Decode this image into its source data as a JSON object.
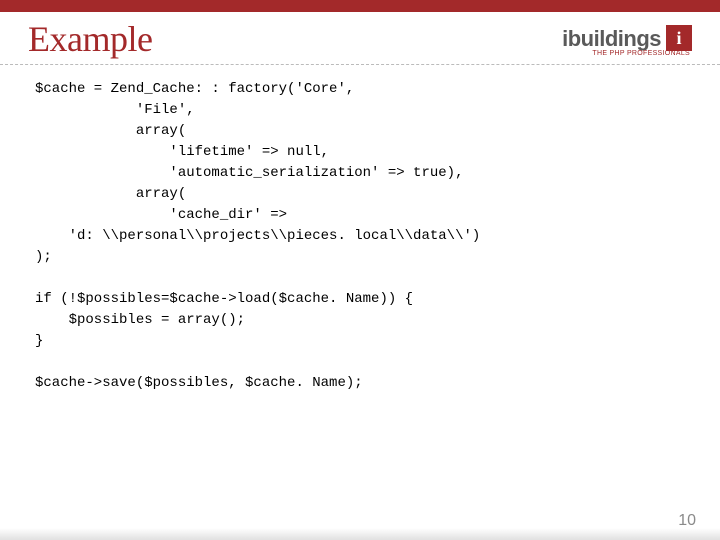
{
  "header": {
    "title": "Example",
    "logo_text": "ibuildings",
    "logo_badge": "i",
    "logo_tagline": "THE PHP PROFESSIONALS"
  },
  "code": "$cache = Zend_Cache: : factory('Core',\n            'File',\n            array(\n                'lifetime' => null,\n                'automatic_serialization' => true),\n            array(\n                'cache_dir' =>\n    'd: \\\\personal\\\\projects\\\\pieces. local\\\\data\\\\')\n);\n\nif (!$possibles=$cache->load($cache. Name)) {\n    $possibles = array();\n}\n\n$cache->save($possibles, $cache. Name);",
  "page_number": "10"
}
